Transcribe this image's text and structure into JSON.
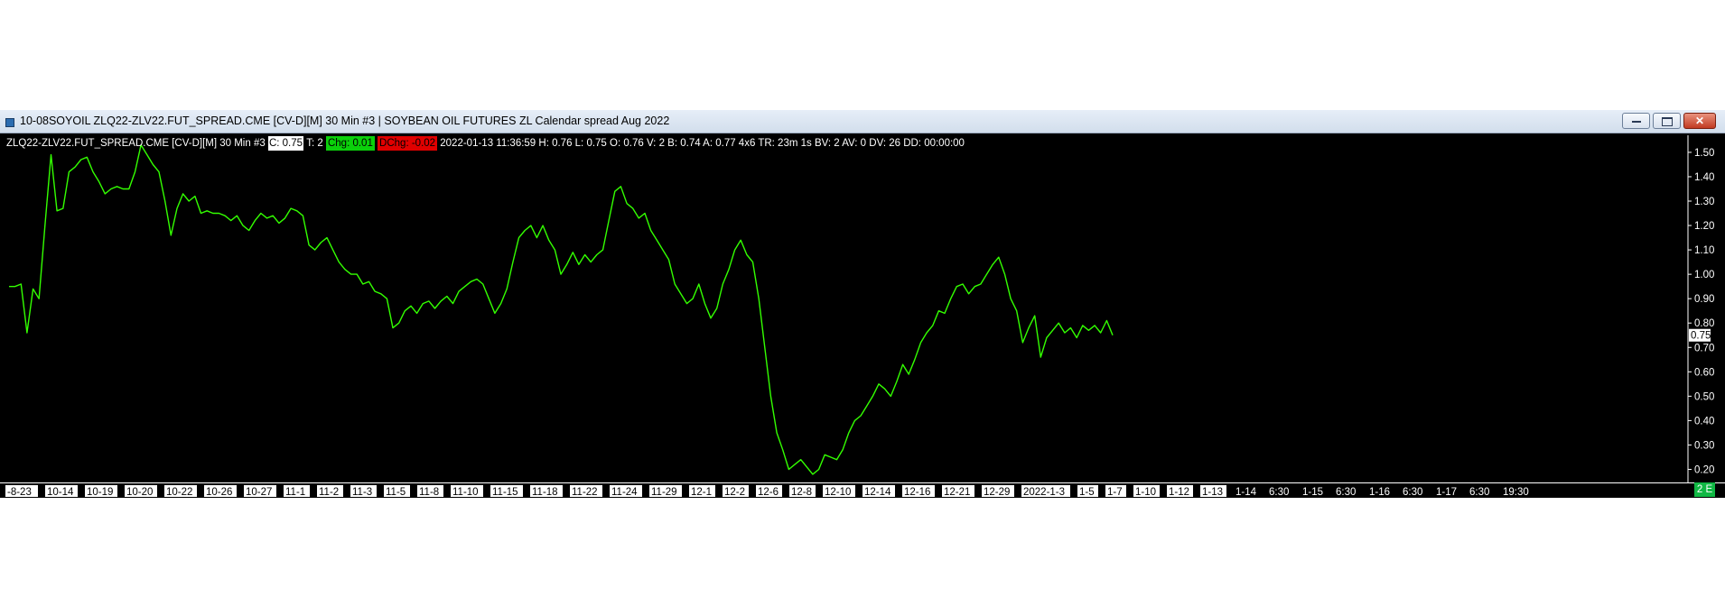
{
  "window": {
    "title": "10-08SOYOIL ZLQ22-ZLV22.FUT_SPREAD.CME [CV-D][M]  30 Min   #3 | SOYBEAN OIL FUTURES ZL Calendar spread Aug 2022",
    "buttons": {
      "minimize": "",
      "maximize": "",
      "close": "✕"
    }
  },
  "infobar": {
    "symbol": "ZLQ22-ZLV22.FUT_SPREAD.CME [CV-D][M]  30 Min   #3",
    "close": "C: 0.75",
    "ticks": "T: 2",
    "chg": "Chg: 0.01",
    "dchg": "DChg: -0.02",
    "details": "2022-01-13 11:36:59 H: 0.76 L: 0.75 O: 0.76 V: 2 B: 0.74 A: 0.77 4x6 TR: 23m 1s BV: 2 AV: 0 DV: 26 DD: 00:00:00"
  },
  "status_badge": "2 E",
  "colors": {
    "background": "#000000",
    "series": "#33ff00",
    "text": "#ffffff",
    "positive": "#0bd00b",
    "negative": "#e00000"
  },
  "chart_data": {
    "type": "line",
    "ylim": [
      0.15,
      1.57
    ],
    "y_ticks": [
      "0.20",
      "0.30",
      "0.40",
      "0.50",
      "0.60",
      "0.70",
      "0.80",
      "0.90",
      "1.00",
      "1.10",
      "1.20",
      "1.30",
      "1.40",
      "1.50"
    ],
    "last_value_label": "0.75",
    "x_ticks": [
      "-8-23",
      "10-14",
      "10-19",
      "10-20",
      "10-22",
      "10-26",
      "10-27",
      "11-1",
      "11-2",
      "11-3",
      "11-5",
      "11-8",
      "11-10",
      "11-15",
      "11-18",
      "11-22",
      "11-24",
      "11-29",
      "12-1",
      "12-2",
      "12-6",
      "12-8",
      "12-10",
      "12-14",
      "12-16",
      "12-21",
      "12-29",
      "2022-1-3",
      "1-5",
      "1-7",
      "1-10",
      "1-12",
      "1-13",
      "1-14",
      "6:30",
      "1-15",
      "6:30",
      "1-16",
      "6:30",
      "1-17",
      "6:30",
      "19:30"
    ],
    "x_ticks_highlighted": [
      true,
      true,
      true,
      true,
      true,
      true,
      true,
      true,
      true,
      true,
      true,
      true,
      true,
      true,
      true,
      true,
      true,
      true,
      true,
      true,
      true,
      true,
      true,
      true,
      true,
      true,
      true,
      true,
      true,
      true,
      true,
      true,
      true,
      false,
      false,
      false,
      false,
      false,
      false,
      false,
      false,
      false
    ],
    "series": [
      {
        "values": [
          0.95,
          0.95,
          0.96,
          0.76,
          0.94,
          0.9,
          1.2,
          1.49,
          1.26,
          1.27,
          1.42,
          1.44,
          1.47,
          1.48,
          1.42,
          1.38,
          1.33,
          1.35,
          1.36,
          1.35,
          1.35,
          1.42,
          1.53,
          1.49,
          1.45,
          1.42,
          1.3,
          1.16,
          1.27,
          1.33,
          1.3,
          1.32,
          1.25,
          1.26,
          1.25,
          1.25,
          1.24,
          1.22,
          1.24,
          1.2,
          1.18,
          1.22,
          1.25,
          1.23,
          1.24,
          1.21,
          1.23,
          1.27,
          1.26,
          1.24,
          1.12,
          1.1,
          1.13,
          1.15,
          1.1,
          1.05,
          1.02,
          1.0,
          1.0,
          0.96,
          0.97,
          0.93,
          0.92,
          0.9,
          0.78,
          0.8,
          0.85,
          0.87,
          0.84,
          0.88,
          0.89,
          0.86,
          0.89,
          0.91,
          0.88,
          0.93,
          0.95,
          0.97,
          0.98,
          0.96,
          0.9,
          0.84,
          0.88,
          0.94,
          1.05,
          1.15,
          1.18,
          1.2,
          1.15,
          1.2,
          1.14,
          1.1,
          1.0,
          1.04,
          1.09,
          1.04,
          1.08,
          1.05,
          1.08,
          1.1,
          1.22,
          1.34,
          1.36,
          1.29,
          1.27,
          1.23,
          1.25,
          1.18,
          1.14,
          1.1,
          1.06,
          0.96,
          0.92,
          0.88,
          0.9,
          0.96,
          0.88,
          0.82,
          0.86,
          0.96,
          1.02,
          1.1,
          1.14,
          1.08,
          1.05,
          0.9,
          0.7,
          0.5,
          0.35,
          0.28,
          0.2,
          0.22,
          0.24,
          0.21,
          0.18,
          0.2,
          0.26,
          0.25,
          0.24,
          0.28,
          0.35,
          0.4,
          0.42,
          0.46,
          0.5,
          0.55,
          0.53,
          0.5,
          0.56,
          0.63,
          0.59,
          0.65,
          0.72,
          0.76,
          0.79,
          0.85,
          0.84,
          0.9,
          0.95,
          0.96,
          0.92,
          0.95,
          0.96,
          1.0,
          1.04,
          1.07,
          1.0,
          0.9,
          0.85,
          0.72,
          0.78,
          0.83,
          0.66,
          0.74,
          0.77,
          0.8,
          0.76,
          0.78,
          0.74,
          0.79,
          0.77,
          0.79,
          0.76,
          0.81,
          0.75
        ]
      }
    ]
  }
}
